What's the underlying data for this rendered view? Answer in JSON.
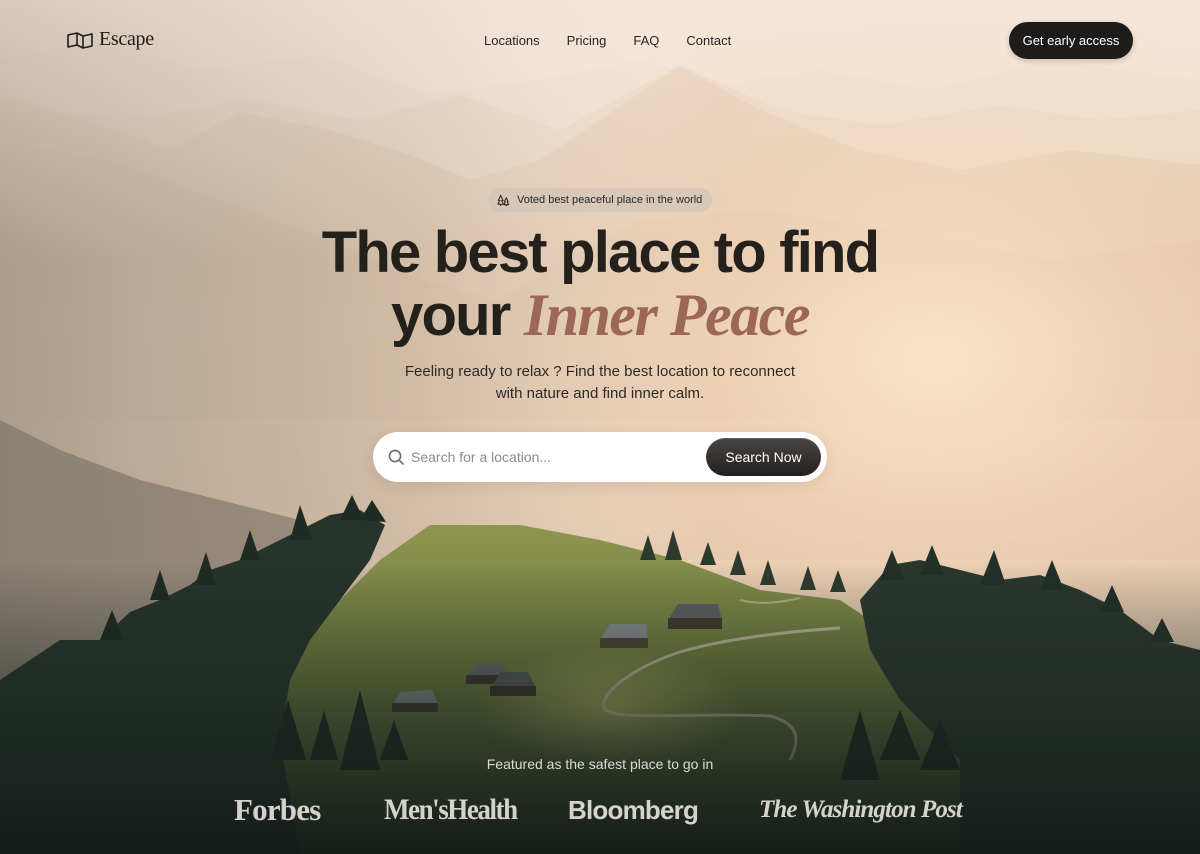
{
  "header": {
    "brand": "Escape",
    "nav": [
      "Locations",
      "Pricing",
      "FAQ",
      "Contact"
    ],
    "cta_label": "Get early access"
  },
  "hero": {
    "badge": "Voted best peaceful place in the world",
    "headline_line1": "The best place to find",
    "headline_line2_plain": "your",
    "headline_line2_accent": "Inner Peace",
    "subtext_line1": "Feeling ready to relax ? Find the best location to reconnect",
    "subtext_line2": "with nature and find inner calm."
  },
  "search": {
    "placeholder": "Search for a location...",
    "button_label": "Search Now"
  },
  "featured": {
    "label": "Featured as the safest place to go in",
    "logos": [
      "Forbes",
      "Men'sHealth",
      "Bloomberg",
      "The Washington Post"
    ]
  },
  "colors": {
    "accent": "#9c6658",
    "dark_button": "#1e1c1a",
    "text_dark": "#24211d"
  },
  "icons": {
    "logo": "flag-icon",
    "badge": "tree-icon",
    "search": "search-icon"
  }
}
